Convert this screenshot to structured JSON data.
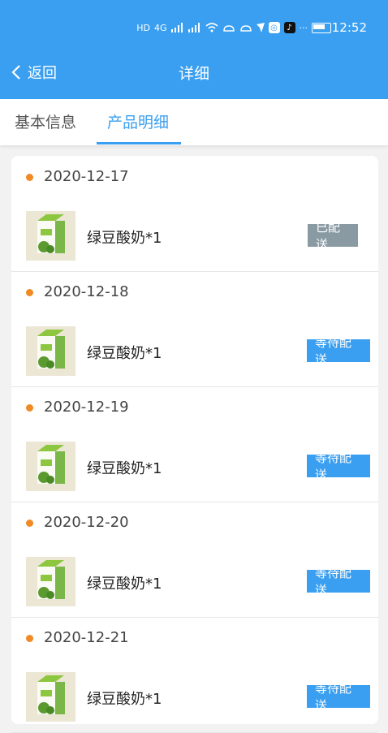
{
  "status_bar": {
    "time": "12:52",
    "net1": "HD",
    "net2": "4G",
    "more": "···"
  },
  "nav": {
    "back_label": "返回",
    "title": "详细"
  },
  "tabs": [
    {
      "label": "基本信息",
      "active": false
    },
    {
      "label": "产品明细",
      "active": true
    }
  ],
  "colors": {
    "primary": "#3a9ff0",
    "dot": "#f08a24",
    "done_badge": "#8a9aa3"
  },
  "entries": [
    {
      "date": "2020-12-17",
      "product": "绿豆酸奶*1",
      "status": "已配送"
    },
    {
      "date": "2020-12-18",
      "product": "绿豆酸奶*1",
      "status": "等待配送"
    },
    {
      "date": "2020-12-19",
      "product": "绿豆酸奶*1",
      "status": "等待配送"
    },
    {
      "date": "2020-12-20",
      "product": "绿豆酸奶*1",
      "status": "等待配送"
    },
    {
      "date": "2020-12-21",
      "product": "绿豆酸奶*1",
      "status": "等待配送"
    }
  ]
}
